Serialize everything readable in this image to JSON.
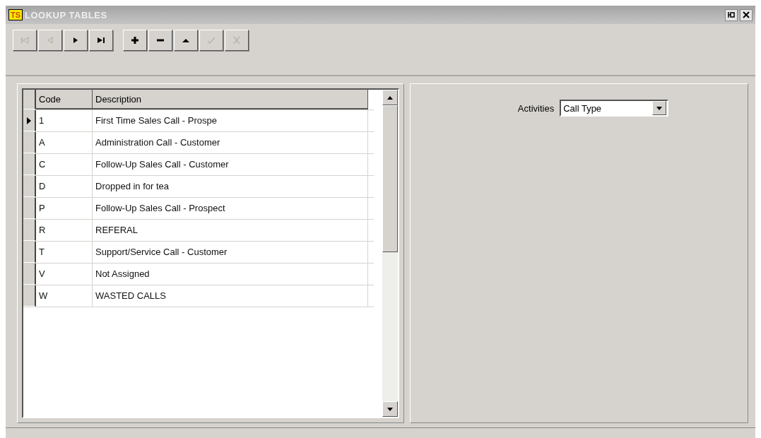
{
  "window": {
    "title": "LOOKUP TABLES",
    "logo": "TS"
  },
  "toolbar": [
    {
      "kind": "first",
      "disabled": true
    },
    {
      "kind": "prev",
      "disabled": true
    },
    {
      "kind": "next",
      "disabled": false
    },
    {
      "kind": "last",
      "disabled": false
    },
    {
      "kind": "add",
      "disabled": false
    },
    {
      "kind": "delete",
      "disabled": false
    },
    {
      "kind": "edit",
      "disabled": false
    },
    {
      "kind": "post",
      "disabled": true
    },
    {
      "kind": "cancel",
      "disabled": true
    }
  ],
  "table": {
    "columns": [
      "Code",
      "Description"
    ],
    "rows": [
      {
        "code": "1",
        "description": "First Time Sales Call - Prospe",
        "selected": true
      },
      {
        "code": "A",
        "description": "Administration Call - Customer",
        "selected": false
      },
      {
        "code": "C",
        "description": "Follow-Up Sales Call - Customer",
        "selected": false
      },
      {
        "code": "D",
        "description": "Dropped in for tea",
        "selected": false
      },
      {
        "code": "P",
        "description": "Follow-Up Sales Call - Prospect",
        "selected": false
      },
      {
        "code": "R",
        "description": "REFERAL",
        "selected": false
      },
      {
        "code": "T",
        "description": "Support/Service Call - Customer",
        "selected": false
      },
      {
        "code": "V",
        "description": "Not Assigned",
        "selected": false
      },
      {
        "code": "W",
        "description": "WASTED CALLS",
        "selected": false
      }
    ]
  },
  "filter": {
    "label": "Activities",
    "value": "Call Type"
  }
}
